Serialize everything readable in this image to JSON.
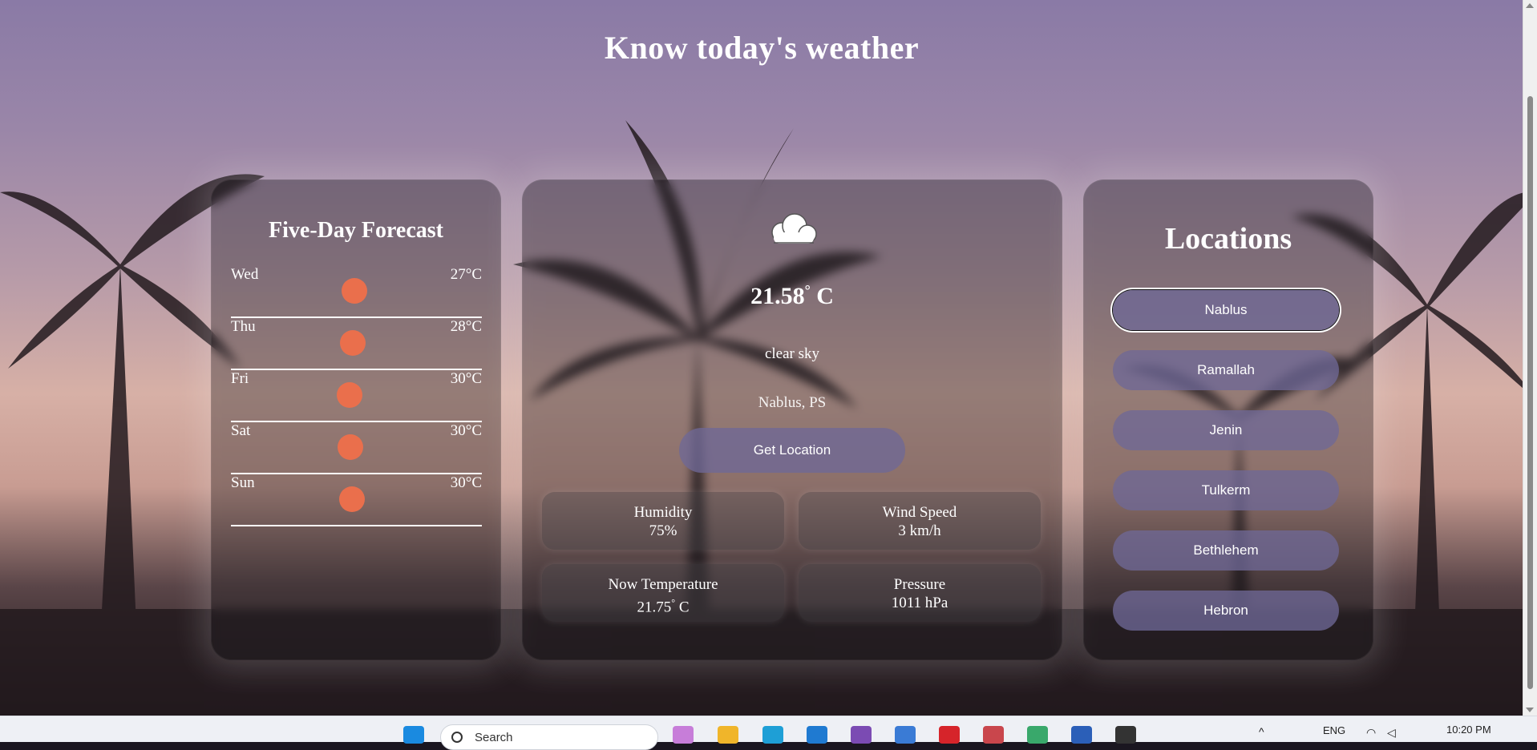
{
  "page": {
    "title": "Know today's weather"
  },
  "forecast": {
    "title": "Five-Day Forecast",
    "days": [
      {
        "day": "Wed",
        "temp": "27°C",
        "icon": "sun-icon"
      },
      {
        "day": "Thu",
        "temp": "28°C",
        "icon": "sun-icon"
      },
      {
        "day": "Fri",
        "temp": "30°C",
        "icon": "sun-icon"
      },
      {
        "day": "Sat",
        "temp": "30°C",
        "icon": "sun-icon"
      },
      {
        "day": "Sun",
        "temp": "30°C",
        "icon": "sun-icon"
      }
    ]
  },
  "current": {
    "icon": "cloud-icon",
    "temperature": "21.58",
    "unit": "C",
    "description": "clear sky",
    "location": "Nablus, PS",
    "get_location_label": "Get Location",
    "stats": [
      {
        "label": "Humidity",
        "value": "75%"
      },
      {
        "label": "Wind Speed",
        "value": "3 km/h"
      },
      {
        "label": "Now Temperature",
        "value": "21.75",
        "unit": "C"
      },
      {
        "label": "Pressure",
        "value": "1011 hPa"
      }
    ]
  },
  "locations": {
    "title": "Locations",
    "items": [
      "Nablus",
      "Ramallah",
      "Jenin",
      "Tulkerm",
      "Bethlehem",
      "Hebron"
    ],
    "selected": "Nablus"
  },
  "taskbar": {
    "search_placeholder": "Search",
    "language": "ENG",
    "time": "10:20 PM"
  },
  "colors": {
    "sun": "#ea6f4c",
    "button": "#6e6896",
    "text": "#ffffff"
  }
}
